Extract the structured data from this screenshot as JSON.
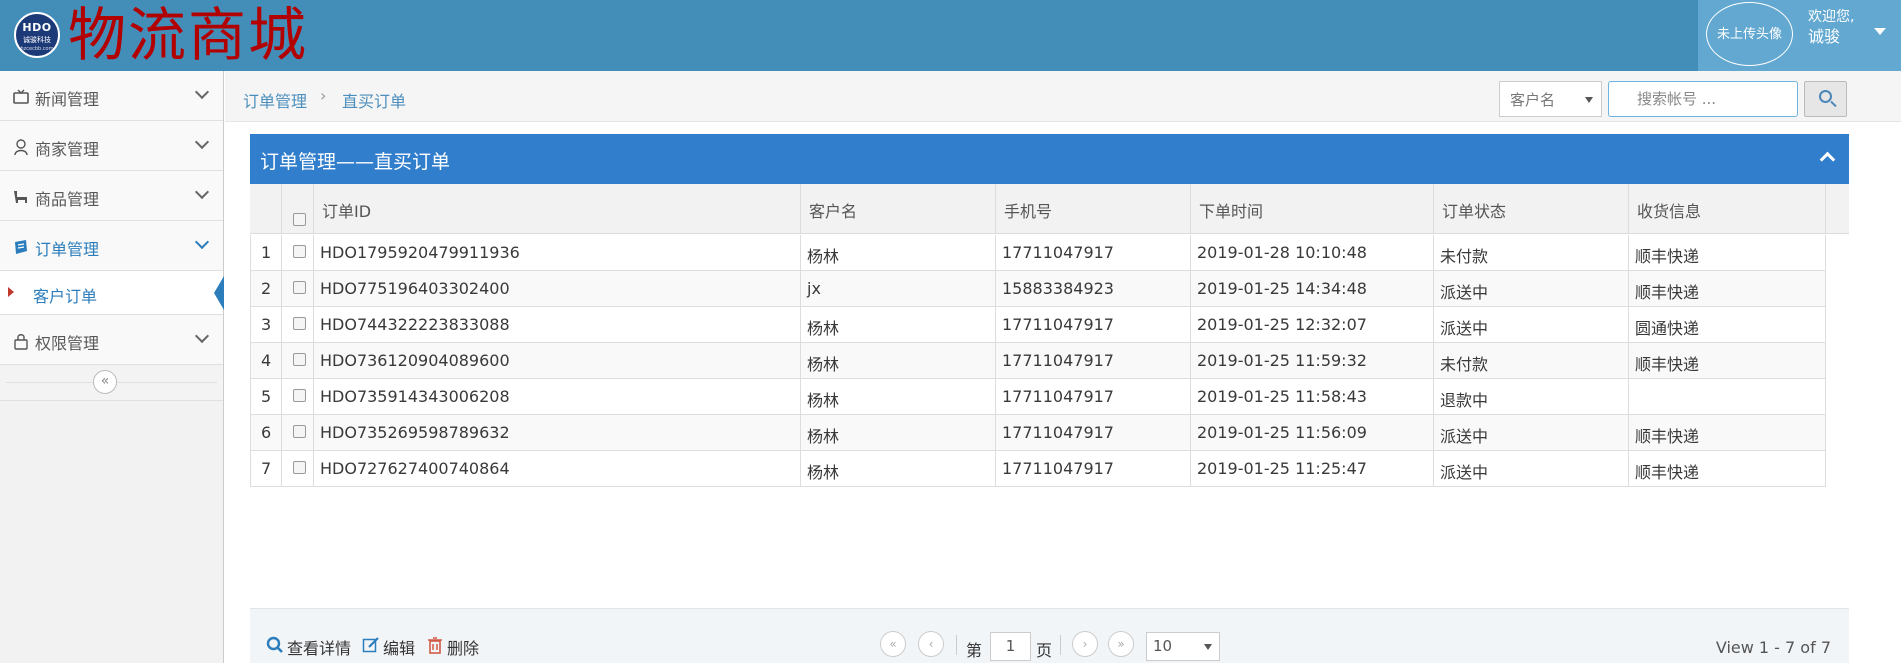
{
  "header": {
    "logo_line1": "HDO",
    "logo_line2": "诚骏科技",
    "logo_line3": "hzcecbb.com",
    "title": "物流商城",
    "avatar_text": "未上传头像",
    "welcome": "欢迎您,",
    "user_name": "诚骏",
    "colors": {
      "bar": "#438eb9",
      "user_area": "#62a8d1",
      "title": "#b20000"
    }
  },
  "sidebar": {
    "items": [
      {
        "label": "新闻管理",
        "icon": "tv-icon"
      },
      {
        "label": "商家管理",
        "icon": "user-icon"
      },
      {
        "label": "商品管理",
        "icon": "product-icon"
      },
      {
        "label": "订单管理",
        "icon": "order-icon"
      },
      {
        "label": "权限管理",
        "icon": "lock-icon"
      }
    ],
    "sub_item": "客户订单",
    "collapse_glyph": "«"
  },
  "breadcrumb": {
    "root": "订单管理",
    "sep": "›",
    "current": "直买订单"
  },
  "search": {
    "field_select": "客户名",
    "placeholder": "搜索帐号 ..."
  },
  "panel": {
    "title": "订单管理——直买订单",
    "accent": "#307ecc"
  },
  "table": {
    "columns": [
      "订单ID",
      "客户名",
      "手机号",
      "下单时间",
      "订单状态",
      "收货信息"
    ],
    "rows": [
      {
        "n": "1",
        "id": "HDO1795920479911936",
        "customer": "杨林",
        "phone": "17711047917",
        "time": "2019-01-28 10:10:48",
        "status": "未付款",
        "ship": "顺丰快递"
      },
      {
        "n": "2",
        "id": "HDO775196403302400",
        "customer": "jx",
        "phone": "15883384923",
        "time": "2019-01-25 14:34:48",
        "status": "派送中",
        "ship": "顺丰快递"
      },
      {
        "n": "3",
        "id": "HDO744322223833088",
        "customer": "杨林",
        "phone": "17711047917",
        "time": "2019-01-25 12:32:07",
        "status": "派送中",
        "ship": "圆通快递"
      },
      {
        "n": "4",
        "id": "HDO736120904089600",
        "customer": "杨林",
        "phone": "17711047917",
        "time": "2019-01-25 11:59:32",
        "status": "未付款",
        "ship": "顺丰快递"
      },
      {
        "n": "5",
        "id": "HDO735914343006208",
        "customer": "杨林",
        "phone": "17711047917",
        "time": "2019-01-25 11:58:43",
        "status": "退款中",
        "ship": ""
      },
      {
        "n": "6",
        "id": "HDO735269598789632",
        "customer": "杨林",
        "phone": "17711047917",
        "time": "2019-01-25 11:56:09",
        "status": "派送中",
        "ship": "顺丰快递"
      },
      {
        "n": "7",
        "id": "HDO727627400740864",
        "customer": "杨林",
        "phone": "17711047917",
        "time": "2019-01-25 11:25:47",
        "status": "派送中",
        "ship": "顺丰快递"
      }
    ]
  },
  "footer": {
    "view_detail": "查看详情",
    "edit": "编辑",
    "delete": "删除",
    "page_prefix": "第",
    "page_value": "1",
    "page_suffix": "页",
    "page_size": "10",
    "view_text": "View 1 - 7 of 7",
    "first": "«",
    "prev": "‹",
    "next": "›",
    "last": "»"
  }
}
